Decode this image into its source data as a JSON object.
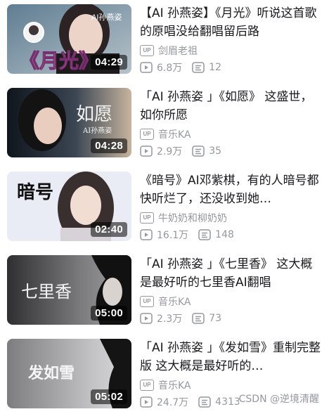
{
  "videos": [
    {
      "title": "【AI 孙燕姿】《月光》听说这首歌的原唱没给翻唱留后路",
      "up_badge": "UP",
      "uploader": "剑眉老祖",
      "views": "6.8万",
      "danmaku": "12",
      "duration": "04:29",
      "thumb_text": "《月光》",
      "thumb_tag": "AI孙燕姿",
      "thumb_colors": [
        "#6d8a9c",
        "#e7d7cf",
        "#ff9fd2"
      ]
    },
    {
      "title": "「AI 孙燕姿 」《如愿》 这盛世，如你所愿",
      "up_badge": "UP",
      "uploader": "音乐KA",
      "views": "2.9万",
      "danmaku": "35",
      "duration": "04:28",
      "thumb_text": "如愿",
      "thumb_tag": "AI孙燕姿",
      "thumb_colors": [
        "#1f2a35",
        "#9b7e6a",
        "#c7b49e"
      ]
    },
    {
      "title": "《暗号》AI邓紫棋，有的人暗号都快听烂了，还没收到她…",
      "up_badge": "UP",
      "uploader": "牛奶奶和柳奶奶",
      "views": "16.1万",
      "danmaku": "148",
      "duration": "02:40",
      "thumb_text": "暗号",
      "thumb_tag": "",
      "thumb_colors": [
        "#eef1f7",
        "#d8dcea",
        "#3a3030"
      ]
    },
    {
      "title": "「AI 孙燕姿 」《七里香》 这大概是最好听的七里香AI翻唱",
      "up_badge": "UP",
      "uploader": "音乐KA",
      "views": "2.3万",
      "danmaku": "73",
      "duration": "05:00",
      "thumb_text": "七里香",
      "thumb_tag": "",
      "thumb_colors": [
        "#2a2a2c",
        "#6e6e70",
        "#a5a5a8"
      ]
    },
    {
      "title": "「AI 孙燕姿 」《发如雪》重制完整版 这大概是最好听的…",
      "up_badge": "UP",
      "uploader": "音乐KA",
      "views": "24.7万",
      "danmaku": "4313",
      "duration": "05:02",
      "thumb_text": "发如雪",
      "thumb_tag": "",
      "thumb_colors": [
        "#8a8a8c",
        "#bdbdbf",
        "#1c1c1e"
      ]
    }
  ],
  "watermark": "CSDN @逆境清醒",
  "icons": {
    "play_count": "play-count-icon",
    "danmaku": "danmaku-icon",
    "up": "up-badge-icon"
  },
  "colors": {
    "title": "#18191c",
    "meta": "#9499a0"
  }
}
